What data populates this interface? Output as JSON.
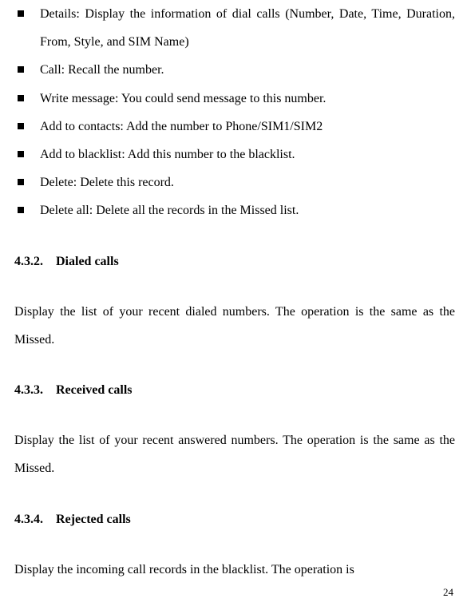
{
  "bullets": [
    "Details: Display the information of dial calls (Number, Date, Time, Duration, From, Style, and SIM Name)",
    "Call: Recall the number.",
    "Write message: You could send message to this number.",
    "Add to contacts: Add the number to Phone/SIM1/SIM2",
    "Add to blacklist: Add this number to the blacklist.",
    "Delete: Delete this record.",
    "Delete all: Delete all the records in the Missed list."
  ],
  "sections": [
    {
      "num": "4.3.2.",
      "title": "Dialed calls",
      "body": "Display the list of your recent dialed numbers. The operation is the same as the Missed."
    },
    {
      "num": "4.3.3.",
      "title": "Received calls",
      "body": "Display the list of your recent answered numbers. The operation is the same as the Missed."
    },
    {
      "num": "4.3.4.",
      "title": "Rejected calls",
      "body": "Display the incoming call records in the blacklist. The operation is"
    }
  ],
  "page_number": "24"
}
